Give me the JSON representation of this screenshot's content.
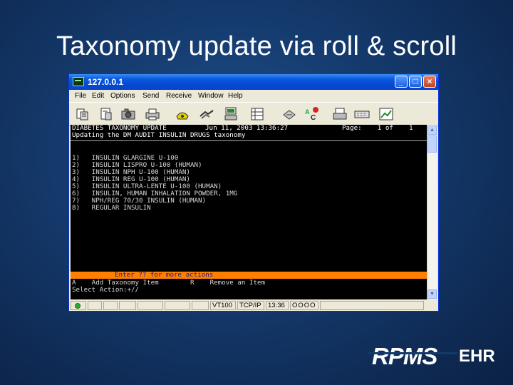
{
  "slide": {
    "title": "Taxonomy update via roll & scroll"
  },
  "window": {
    "title": "127.0.0.1",
    "controls": [
      "_",
      "□",
      "×"
    ],
    "menu": [
      "File",
      "Edit",
      "Options",
      "Send",
      "Receive",
      "Window",
      "Help"
    ],
    "toolbar_icons": [
      "new-session-icon",
      "open-session-icon",
      "camera-icon",
      "print-icon",
      "phone-icon",
      "handshake-icon",
      "transfer-icon",
      "grid-icon",
      "keypad-icon",
      "spellcheck-icon",
      "printer-icon",
      "keyboard-icon",
      "chart-icon"
    ]
  },
  "terminal": {
    "header_left": "DIABETES TAXONOMY UPDATE",
    "header_date": "Jun 11, 2003 13:36:27",
    "header_page": "Page:    1 of    1",
    "subheader": "Updating the DM AUDIT INSULIN DRUGS taxonomy",
    "items": [
      "1)   INSULIN GLARGINE U-100",
      "2)   INSULIN LISPRO U-100 (HUMAN)",
      "3)   INSULIN NPH U-100 (HUMAN)",
      "4)   INSULIN REG U-100 (HUMAN)",
      "5)   INSULIN ULTRA-LENTE U-100 (HUMAN)",
      "6)   INSULIN, HUMAN INHALATION POWDER, 1MG",
      "7)   NPH/REG 70/30 INSULIN (HUMAN)",
      "8)   REGULAR INSULIN"
    ],
    "prompt_bar": "Enter ?? for more actions",
    "actions_line": "A    Add Taxonomy Item        R    Remove an Item",
    "select_line": "Select Action:+//"
  },
  "statusbar": {
    "emulation": "VT100",
    "protocol": "TCP/IP",
    "time": "13:36",
    "lights": "OOOO"
  },
  "logo": {
    "rpms": "RPMS",
    "ehr": "EHR"
  }
}
